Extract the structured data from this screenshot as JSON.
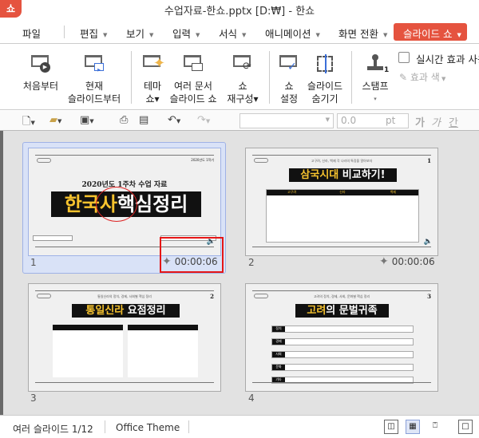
{
  "window": {
    "title": "수업자료-한쇼.pptx [D:₩] - 한쇼",
    "logo": "쇼"
  },
  "menu": {
    "items": [
      {
        "label": "파일"
      },
      {
        "label": "편집"
      },
      {
        "label": "보기"
      },
      {
        "label": "입력"
      },
      {
        "label": "서식"
      },
      {
        "label": "애니메이션"
      },
      {
        "label": "화면 전환"
      },
      {
        "label": "슬라이드 쇼"
      }
    ],
    "dropdown_glyph": "▼",
    "active": "슬라이드 쇼",
    "accent": "#e5533f"
  },
  "ribbon": {
    "buttons": [
      {
        "l1": "처음부터",
        "l2": "",
        "icon": "play-from-start-icon"
      },
      {
        "l1": "현재",
        "l2": "슬라이드부터",
        "icon": "play-from-current-icon"
      },
      {
        "l1": "테마",
        "l2": "쇼▾",
        "icon": "theme-show-icon"
      },
      {
        "l1": "여러 문서",
        "l2": "슬라이드 쇼",
        "icon": "multi-doc-show-icon"
      },
      {
        "l1": "쇼",
        "l2": "재구성▾",
        "icon": "custom-show-icon"
      },
      {
        "l1": "쇼",
        "l2": "설정",
        "icon": "show-setup-icon"
      },
      {
        "l1": "슬라이드",
        "l2": "숨기기",
        "icon": "hide-slide-icon"
      },
      {
        "l1": "스탬프",
        "l2": "▾",
        "icon": "stamp-icon"
      }
    ],
    "realtime_effect": "실시간 효과 사용",
    "effect_color": "효과 색"
  },
  "toolbar": {
    "font_size": "0.0",
    "unit": "pt",
    "fmt": [
      "가",
      "가",
      "간"
    ]
  },
  "slides": [
    {
      "number": "1",
      "time": "00:00:06",
      "tag_right": "2020년도 1학기",
      "subtitle": "2020년도 1주차 수업 자료",
      "title_y": "한국사",
      "title_w": "핵심정리",
      "selected": true
    },
    {
      "number": "2",
      "time": "00:00:06",
      "page": "1",
      "head": "고구려, 신라, 백제 각 나라의 특징을 알아보자",
      "title_y": "삼국시대",
      "title_w": " 비교하기!",
      "cols": [
        "고구려",
        "신라",
        "백제"
      ]
    },
    {
      "number": "3",
      "page": "2",
      "head": "통일신라의 정치, 경제, 사회별 핵심 정리",
      "title_y": "통일신라",
      "title_w": " 요점정리"
    },
    {
      "number": "4",
      "page": "3",
      "head": "고려의 정치, 경제, 사회, 문화별 핵심 정리",
      "title_y": "고려",
      "title_w": "의 문벌귀족",
      "rows": [
        "정치",
        "경제",
        "사회",
        "문화",
        "기타"
      ]
    }
  ],
  "status": {
    "view": "여러 슬라이드 1/12",
    "theme": "Office Theme"
  }
}
